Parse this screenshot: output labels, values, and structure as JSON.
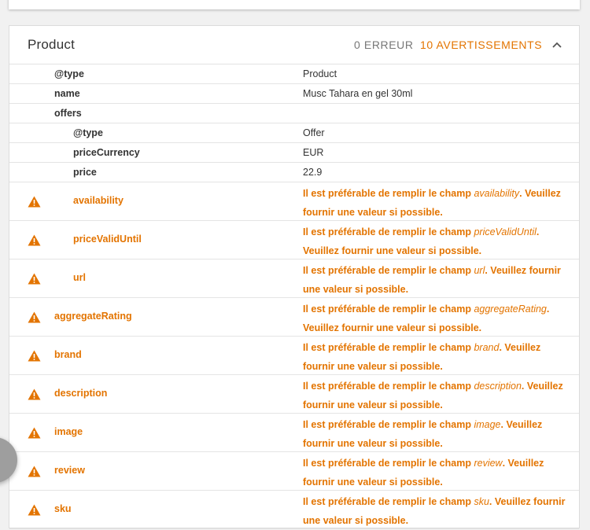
{
  "header": {
    "title": "Product",
    "errors": "0 ERREUR",
    "warnings": "10 AVERTISSEMENTS"
  },
  "colors": {
    "warning": "#e37400",
    "text": "#333333",
    "divider": "#e4e4e4"
  },
  "rows": [
    {
      "key": "@type",
      "value": "Product",
      "level": 0
    },
    {
      "key": "name",
      "value": "Musc Tahara en gel 30ml",
      "level": 0
    },
    {
      "key": "offers",
      "value": "",
      "level": 0
    },
    {
      "key": "@type",
      "value": "Offer",
      "level": 1
    },
    {
      "key": "priceCurrency",
      "value": "EUR",
      "level": 1
    },
    {
      "key": "price",
      "value": "22.9",
      "level": 1
    }
  ],
  "warnings": [
    {
      "key": "availability",
      "level": 1,
      "pre": "Il est préférable de remplir le champ ",
      "field": "availability",
      "post": ". Veuillez fournir une valeur si possible."
    },
    {
      "key": "priceValidUntil",
      "level": 1,
      "pre": "Il est préférable de remplir le champ ",
      "field": "priceValidUntil",
      "post": ". Veuillez fournir une valeur si possible."
    },
    {
      "key": "url",
      "level": 1,
      "pre": "Il est préférable de remplir le champ ",
      "field": "url",
      "post": ". Veuillez fournir une valeur si possible."
    },
    {
      "key": "aggregateRating",
      "level": 0,
      "pre": "Il est préférable de remplir le champ ",
      "field": "aggregateRating",
      "post": ". Veuillez fournir une valeur si possible."
    },
    {
      "key": "brand",
      "level": 0,
      "pre": "Il est préférable de remplir le champ ",
      "field": "brand",
      "post": ". Veuillez fournir une valeur si possible."
    },
    {
      "key": "description",
      "level": 0,
      "pre": "Il est préférable de remplir le champ ",
      "field": "description",
      "post": ". Veuillez fournir une valeur si possible."
    },
    {
      "key": "image",
      "level": 0,
      "pre": "Il est préférable de remplir le champ ",
      "field": "image",
      "post": ". Veuillez fournir une valeur si possible."
    },
    {
      "key": "review",
      "level": 0,
      "pre": "Il est préférable de remplir le champ ",
      "field": "review",
      "post": ". Veuillez fournir une valeur si possible."
    },
    {
      "key": "sku",
      "level": 0,
      "pre": "Il est préférable de remplir le champ ",
      "field": "sku",
      "post": ". Veuillez fournir une valeur si possible."
    }
  ]
}
